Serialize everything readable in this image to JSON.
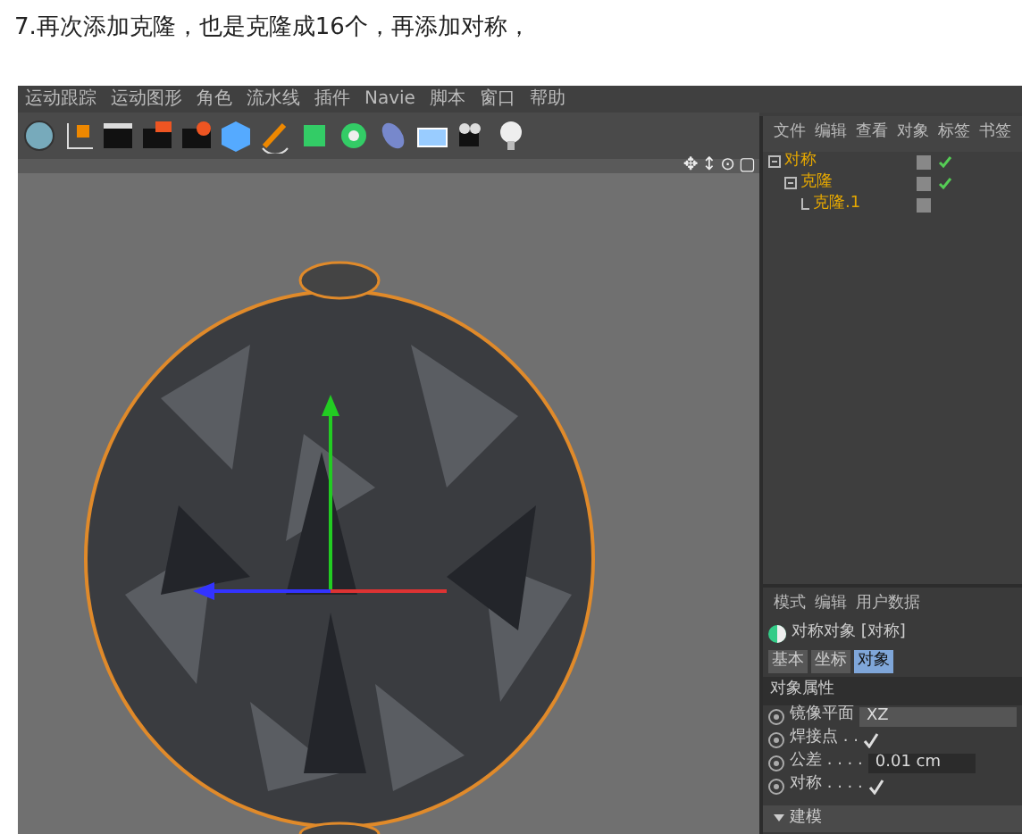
{
  "caption": "7.再次添加克隆，也是克隆成16个，再添加对称，",
  "app": {
    "menu": [
      "运动跟踪",
      "运动图形",
      "角色",
      "流水线",
      "插件",
      "Navie",
      "脚本",
      "窗口",
      "帮助"
    ],
    "viewport": {
      "nav_icons": [
        "✥",
        "↕",
        "⊙",
        "▢"
      ]
    },
    "object_manager": {
      "menu": [
        "文件",
        "编辑",
        "查看",
        "对象",
        "标签",
        "书签"
      ],
      "objects": [
        {
          "name": "对称",
          "checked": true,
          "children": [
            {
              "name": "克隆",
              "checked": true,
              "children": [
                {
                  "name": "克隆.1",
                  "checked": false
                }
              ]
            }
          ]
        }
      ]
    },
    "attributes": {
      "menu": [
        "模式",
        "编辑",
        "用户数据"
      ],
      "object_title": "对称对象 [对称]",
      "tabs": [
        {
          "label": "基本",
          "selected": false
        },
        {
          "label": "坐标",
          "selected": false
        },
        {
          "label": "对象",
          "selected": true
        }
      ],
      "section": "对象属性",
      "fields": [
        {
          "kind": "select",
          "label": "镜像平面",
          "value": "XZ"
        },
        {
          "kind": "checkbox",
          "label": "焊接点 . .",
          "checked": true
        },
        {
          "kind": "number",
          "label": "公差 . . . .",
          "value": "0.01 cm"
        },
        {
          "kind": "checkbox",
          "label": "对称 . . . .",
          "checked": true
        }
      ],
      "group": "建模"
    }
  }
}
